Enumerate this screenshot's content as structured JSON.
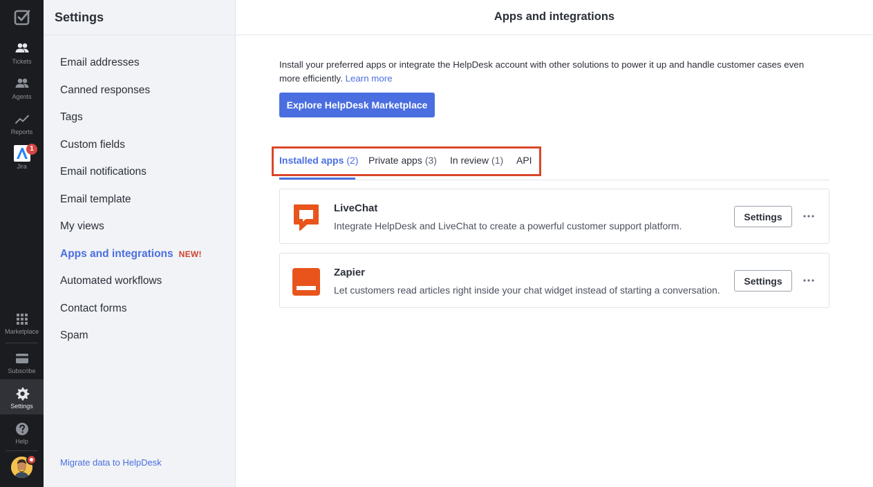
{
  "rail": {
    "items": [
      {
        "label": "Tickets",
        "icon": "tickets-icon"
      },
      {
        "label": "Agents",
        "icon": "agents-icon"
      },
      {
        "label": "Reports",
        "icon": "reports-icon"
      },
      {
        "label": "Jira",
        "icon": "jira-icon",
        "badge": "1"
      },
      {
        "label": "Marketplace",
        "icon": "marketplace-icon"
      },
      {
        "label": "Subscribe",
        "icon": "subscribe-icon"
      },
      {
        "label": "Settings",
        "icon": "settings-icon"
      },
      {
        "label": "Help",
        "icon": "help-icon"
      }
    ],
    "active": "Settings"
  },
  "sidebar": {
    "title": "Settings",
    "items": [
      {
        "label": "Email addresses"
      },
      {
        "label": "Canned responses"
      },
      {
        "label": "Tags"
      },
      {
        "label": "Custom fields"
      },
      {
        "label": "Email notifications"
      },
      {
        "label": "Email template"
      },
      {
        "label": "My views"
      },
      {
        "label": "Apps and integrations",
        "badge": "NEW!"
      },
      {
        "label": "Automated workflows"
      },
      {
        "label": "Contact forms"
      },
      {
        "label": "Spam"
      }
    ],
    "active": "Apps and integrations",
    "footer_link": "Migrate data to HelpDesk"
  },
  "main": {
    "title": "Apps and integrations",
    "intro": "Install your preferred apps or integrate the HelpDesk account with other solutions to power it up and handle customer cases even more efficiently.",
    "learn_more": "Learn more",
    "marketplace_button": "Explore HelpDesk Marketplace",
    "tabs": [
      {
        "label": "Installed apps",
        "count": "(2)"
      },
      {
        "label": "Private apps",
        "count": "(3)"
      },
      {
        "label": "In review",
        "count": "(1)"
      },
      {
        "label": "API",
        "count": ""
      }
    ],
    "active_tab": "Installed apps",
    "apps": [
      {
        "name": "LiveChat",
        "description": "Integrate HelpDesk and LiveChat to create a powerful customer support platform.",
        "button": "Settings",
        "icon": "livechat-icon"
      },
      {
        "name": "Zapier",
        "description": "Let customers read articles right inside your chat widget instead of starting a conversation.",
        "button": "Settings",
        "icon": "zapier-icon"
      }
    ]
  },
  "colors": {
    "accent": "#4a6ee0",
    "rail_bg": "#1b1c1f",
    "sidebar_bg": "#f1f3f6",
    "brand_orange": "#e8541c",
    "new_badge": "#d0422f",
    "highlight_box": "#d9472b"
  }
}
